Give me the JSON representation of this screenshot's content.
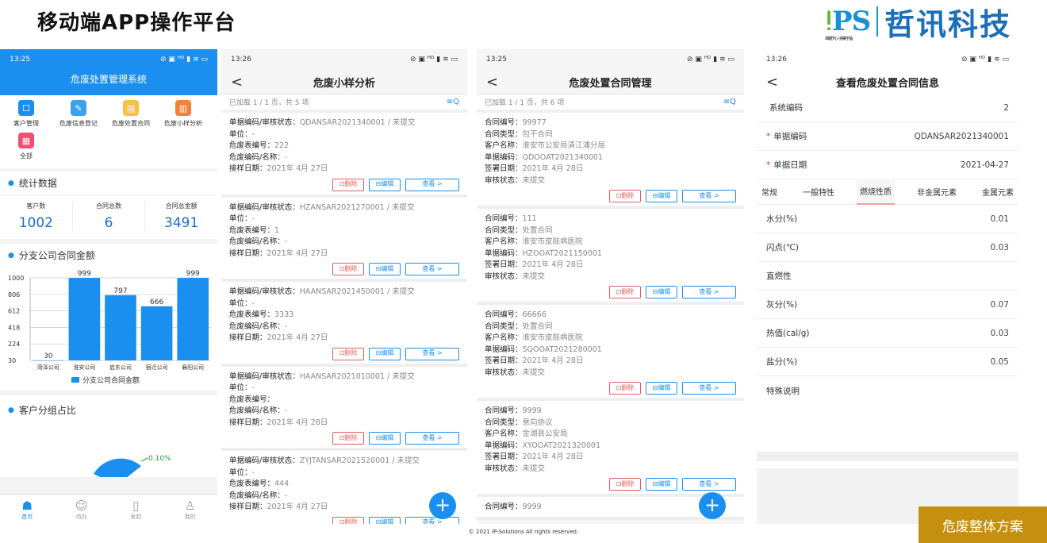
{
  "slide": {
    "title": "移动端APP操作平台",
    "logo_text": "PS",
    "logo_tagline": "卓越于心 · 完美于品",
    "logo_company": "哲讯科技",
    "footer": "© 2021 iP-Solutions All rights reserved.",
    "badge": "危废整体方案"
  },
  "phone1": {
    "time": "13:25",
    "status_icons": "⊘ ▣ ᴴᴰ ▮ ≋ ▭",
    "title": "危废处置管理系统",
    "grid": [
      {
        "label": "客户管理",
        "icon": "customer-icon",
        "color": "#1a8ff0"
      },
      {
        "label": "危废信息登记",
        "icon": "register-icon",
        "color": "#3aa0f0"
      },
      {
        "label": "危废处置合同",
        "icon": "contract-icon",
        "color": "#f5c242"
      },
      {
        "label": "危废小样分析",
        "icon": "analysis-icon",
        "color": "#f0823a"
      },
      {
        "label": "全部",
        "icon": "all-icon",
        "color": "#f0506e"
      }
    ],
    "stats_title": "统计数据",
    "stats": [
      {
        "label": "客户数",
        "value": "1002"
      },
      {
        "label": "合同总数",
        "value": "6"
      },
      {
        "label": "合同总金额",
        "value": "3491"
      }
    ],
    "chart_title": "分支公司合同金额",
    "pie_title": "客户分组占比",
    "pie_label": "0.10%",
    "tabs": [
      {
        "label": "首页",
        "icon": "home-icon"
      },
      {
        "label": "待办",
        "icon": "todo-icon"
      },
      {
        "label": "发起",
        "icon": "start-icon"
      },
      {
        "label": "我的",
        "icon": "user-icon"
      }
    ]
  },
  "chart_data": {
    "type": "bar",
    "categories": [
      "菏泽公司",
      "淮安公司",
      "启东公司",
      "宿迁公司",
      "襄阳公司"
    ],
    "series": [
      {
        "name": "分支公司合同金额",
        "values": [
          30,
          999,
          797,
          666,
          999
        ]
      }
    ],
    "y_ticks": [
      30,
      224,
      418,
      612,
      806,
      1000
    ],
    "ylim": [
      30,
      1000
    ],
    "legend": "bottom",
    "color": "#1a8ff0"
  },
  "phone2": {
    "time": "13:26",
    "status_icons": "⊘ ▣ ᴴᴰ ▮ ≋ ▭",
    "title": "危废小样分析",
    "back": "<",
    "loaded": "已加载 1 / 1 页，共 5 项",
    "filter_icon": "≡Q",
    "buttons": {
      "del": "⊡删除",
      "edit": "⊟编辑",
      "view": "查看 >"
    },
    "fab": "+",
    "cards": [
      {
        "l1": "单据编码/审核状态：",
        "v1": "QDANSAR2021340001 / 未提交",
        "l2": "单位：",
        "v2": "-",
        "l3": "危废表编号：",
        "v3": "222",
        "l4": "危废编码/名称：",
        "v4": "-",
        "l5": "接样日期：",
        "v5": "2021年 4月 27日"
      },
      {
        "l1": "单据编码/审核状态：",
        "v1": "HZANSAR2021270001 / 未提交",
        "l2": "单位：",
        "v2": "-",
        "l3": "危废表编号：",
        "v3": "1",
        "l4": "危废编码/名称：",
        "v4": "-",
        "l5": "接样日期：",
        "v5": "2021年 4月 27日"
      },
      {
        "l1": "单据编码/审核状态：",
        "v1": "HAANSAR2021450001 / 未提交",
        "l2": "单位：",
        "v2": "-",
        "l3": "危废表编号：",
        "v3": "3333",
        "l4": "危废编码/名称：",
        "v4": "-",
        "l5": "接样日期：",
        "v5": "2021年 4月 27日"
      },
      {
        "l1": "单据编码/审核状态：",
        "v1": "HAANSAR2021010001 / 未提交",
        "l2": "单位：",
        "v2": "-",
        "l3": "危废表编号：",
        "v3": "",
        "l4": "危废编码/名称：",
        "v4": "-",
        "l5": "接样日期：",
        "v5": "2021年 4月 28日"
      },
      {
        "l1": "单据编码/审核状态：",
        "v1": "ZYJTANSAR2021520001 / 未提交",
        "l2": "单位：",
        "v2": "-",
        "l3": "危废表编号：",
        "v3": "444",
        "l4": "危废编码/名称：",
        "v4": "-",
        "l5": "接样日期：",
        "v5": "2021年 4月 27日"
      }
    ]
  },
  "phone3": {
    "time": "13:25",
    "status_icons": "⊘ ▣ ᴴᴰ ▮ ≋ ▭",
    "title": "危废处置合同管理",
    "back": "<",
    "loaded": "已加载 1 / 1 页，共 6 项",
    "filter_icon": "≡Q",
    "buttons": {
      "del": "⊡删除",
      "edit": "⊟编辑",
      "view": "查看 >"
    },
    "fab": "+",
    "cards": [
      {
        "l1": "合同编号：",
        "v1": "99977",
        "l2": "合同类型：",
        "v2": "包干合同",
        "l3": "客户名称：",
        "v3": "淮安市公安局清江浦分局",
        "l4": "单据编码：",
        "v4": "QDOOAT2021340001",
        "l5": "签署日期：",
        "v5": "2021年 4月 28日",
        "l6": "审核状态：",
        "v6": "未提交"
      },
      {
        "l1": "合同编号：",
        "v1": "111",
        "l2": "合同类型：",
        "v2": "处置合同",
        "l3": "客户名称：",
        "v3": "淮安市皮肤病医院",
        "l4": "单据编码：",
        "v4": "HZOOAT2021150001",
        "l5": "签署日期：",
        "v5": "2021年 4月 28日",
        "l6": "审核状态：",
        "v6": "未提交"
      },
      {
        "l1": "合同编号：",
        "v1": "66666",
        "l2": "合同类型：",
        "v2": "处置合同",
        "l3": "客户名称：",
        "v3": "淮安市皮肤病医院",
        "l4": "单据编码：",
        "v4": "SQOOAT2021280001",
        "l5": "签署日期：",
        "v5": "2021年 4月 28日",
        "l6": "审核状态：",
        "v6": "未提交"
      },
      {
        "l1": "合同编号：",
        "v1": "9999",
        "l2": "合同类型：",
        "v2": "意向协议",
        "l3": "客户名称：",
        "v3": "金湖县公安局",
        "l4": "单据编码：",
        "v4": "XYOOAT2021320001",
        "l5": "签署日期：",
        "v5": "2021年 4月 28日",
        "l6": "审核状态：",
        "v6": "未提交"
      },
      {
        "l1": "合同编号：",
        "v1": "9999",
        "l2": "",
        "v2": "",
        "l3": "",
        "v3": "",
        "l4": "",
        "v4": "",
        "l5": "",
        "v5": "",
        "l6": "",
        "v6": ""
      }
    ]
  },
  "phone4": {
    "time": "13:26",
    "status_icons": "⊘ ▣ ᴴᴰ ▮ ≋ ▭",
    "title": "查看危废处置合同信息",
    "back": "<",
    "top_rows": [
      {
        "label": "系统编码",
        "value": "2",
        "required": ""
      },
      {
        "label": "单据编码",
        "value": "QDANSAR2021340001",
        "required": "*"
      },
      {
        "label": "单据日期",
        "value": "2021-04-27",
        "required": "*"
      }
    ],
    "tabs": [
      "常规",
      "一般特性",
      "燃烧性质",
      "非金属元素",
      "金属元素"
    ],
    "active_tab": "燃烧性质",
    "rows": [
      {
        "label": "水分(%)",
        "value": "0.01"
      },
      {
        "label": "闪点(℃)",
        "value": "0.03"
      },
      {
        "label": "直燃性",
        "value": ""
      },
      {
        "label": "灰分(%)",
        "value": "0.07"
      },
      {
        "label": "热值(cal/g)",
        "value": "0.03"
      },
      {
        "label": "盐分(%)",
        "value": "0.05"
      },
      {
        "label": "特殊说明",
        "value": ""
      }
    ]
  }
}
